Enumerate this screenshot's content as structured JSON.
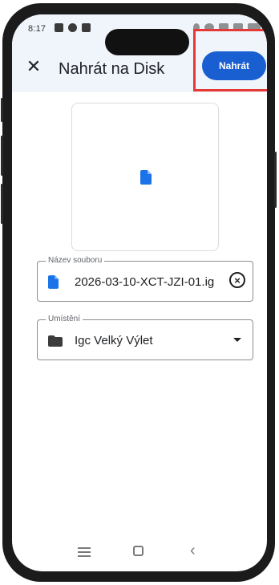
{
  "status_bar": {
    "time": "8:17"
  },
  "header": {
    "close_icon": "close-icon",
    "title": "Nahrát na Disk",
    "upload_label": "Nahrát"
  },
  "preview": {
    "icon": "document-icon"
  },
  "filename_field": {
    "label": "Název souboru",
    "value": "2026-03-10-XCT-JZI-01.ig",
    "icon": "document-icon",
    "clear_icon": "clear-circle-icon"
  },
  "location_field": {
    "label": "Umístění",
    "value": "Igc Velký Výlet",
    "icon": "folder-icon",
    "dropdown_icon": "dropdown-arrow-icon"
  },
  "navigation": {
    "recents_icon": "recents-icon",
    "home_icon": "home-icon",
    "back_icon": "back-icon"
  },
  "colors": {
    "accent": "#1a5fd1",
    "highlight": "#e53935",
    "header_bg": "#f0f5fb"
  }
}
